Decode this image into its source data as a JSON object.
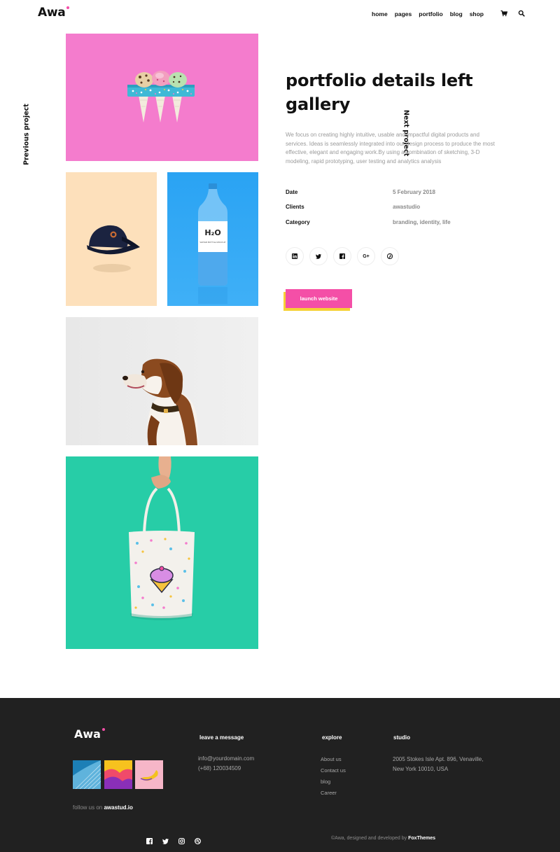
{
  "header": {
    "logo": "Awa",
    "nav": [
      "home",
      "pages",
      "portfolio",
      "blog",
      "shop"
    ]
  },
  "side": {
    "prev": "Previous project",
    "next": "Next project"
  },
  "project": {
    "title": "portfolio details left gallery",
    "description": "We focus on creating highly intuitive, usable and impactful digital products and services. Ideas is seamlessly integrated into our design process to produce the most effective, elegant and engaging work.By using a combination of sketching, 3-D modeling, rapid prototyping, user testing and analytics analysis",
    "meta": {
      "date_label": "Date",
      "date_value": "5 February 2018",
      "clients_label": "Clients",
      "clients_value": "awastudio",
      "category_label": "Category",
      "category_value": "branding, identity, life"
    },
    "launch_label": "launch website"
  },
  "gallery": {
    "bottle_label": "H₂O",
    "bottle_sub": "WATER BOTTLE MOCKUP"
  },
  "footer": {
    "logo": "Awa",
    "follow_prefix": "follow us on",
    "follow_handle": "awastud.io",
    "message_head": "leave a message",
    "email": "info@yourdomain.com",
    "phone": "(+68) 120034509",
    "explore_head": "explore",
    "explore_links": [
      "About us",
      "Contact us",
      "blog",
      "Career"
    ],
    "studio_head": "studio",
    "address_line1": "2005 Stokes Isle Apt. 896, Venaville,",
    "address_line2": "New York 10010, USA",
    "copyright_prefix": "©Awa, designed and developed by",
    "copyright_brand": "FoxThemes"
  },
  "colors": {
    "accent_pink": "#f44fa7",
    "accent_yellow": "#f6d135",
    "footer_bg": "#212121"
  },
  "icons": {
    "header": [
      "cart-icon",
      "search-icon"
    ],
    "share": [
      "linkedin-icon",
      "twitter-icon",
      "facebook-icon",
      "google-plus-icon",
      "pinterest-icon"
    ],
    "footer": [
      "facebook-icon",
      "twitter-icon",
      "instagram-icon",
      "dribbble-icon"
    ]
  }
}
